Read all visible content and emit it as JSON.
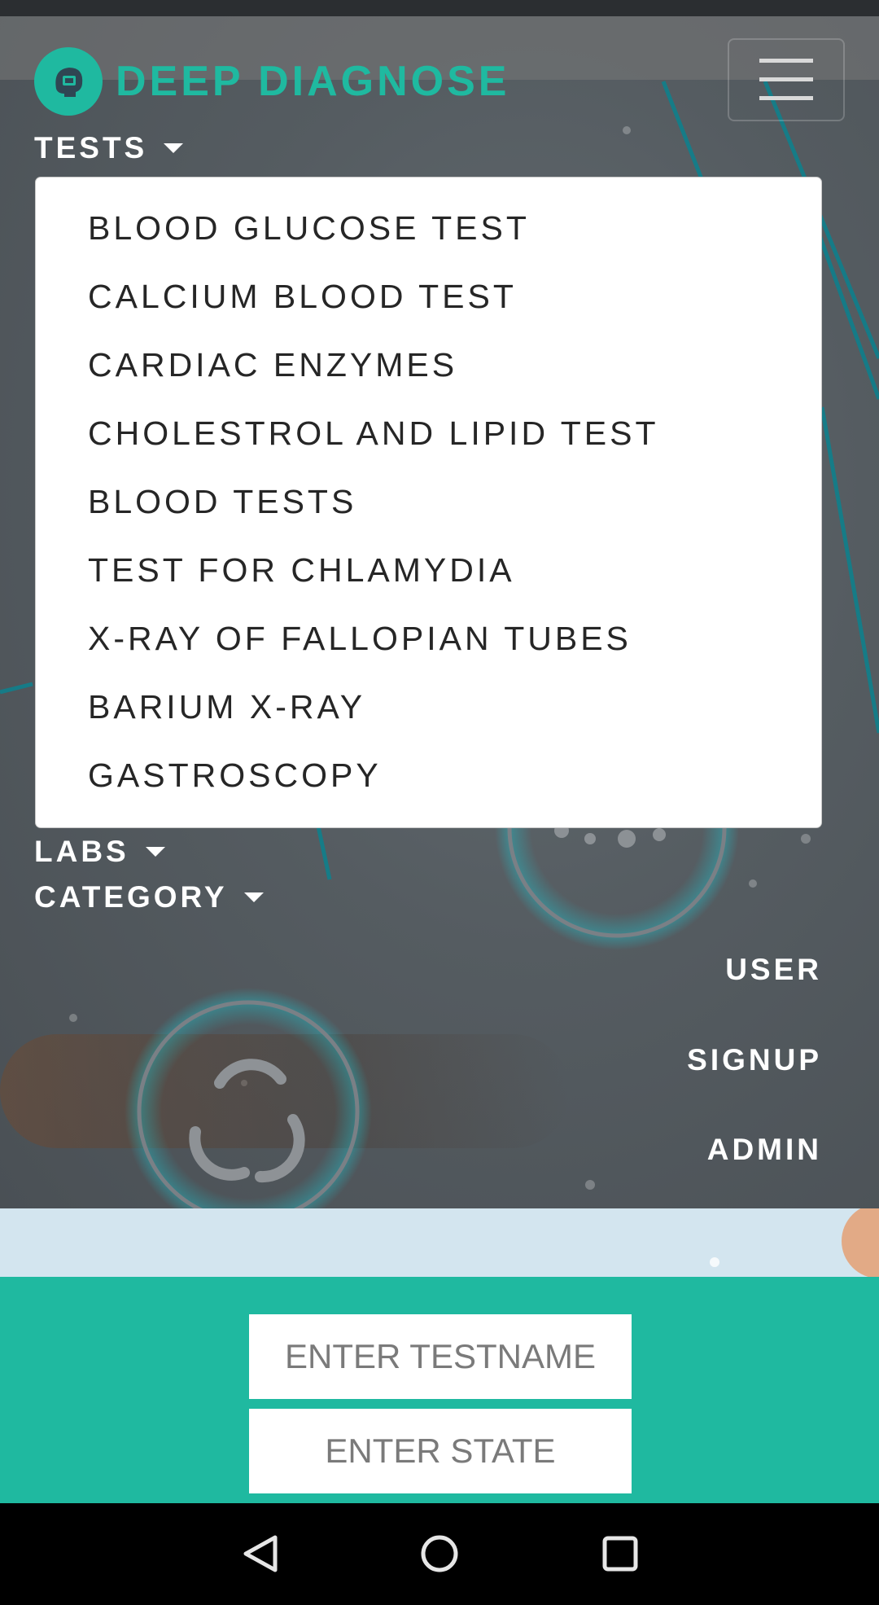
{
  "brand": {
    "name": "DEEP DIAGNOSE",
    "accent_color": "#1fb9a0",
    "logo_icon": "brain-scan-icon"
  },
  "header": {
    "menu_icon": "hamburger-menu-icon"
  },
  "nav": {
    "tests_label": "TESTS",
    "labs_label": "LABS",
    "category_label": "CATEGORY",
    "user_label": "USER",
    "signup_label": "SIGNUP",
    "admin_label": "ADMIN"
  },
  "tests_dropdown": {
    "items": [
      "BLOOD GLUCOSE TEST",
      "CALCIUM BLOOD TEST",
      "CARDIAC ENZYMES",
      "CHOLESTROL AND LIPID TEST",
      "BLOOD TESTS",
      "TEST FOR CHLAMYDIA",
      "X-RAY OF FALLOPIAN TUBES",
      "BARIUM X-RAY",
      "GASTROSCOPY"
    ]
  },
  "search": {
    "testname_placeholder": "ENTER TESTNAME",
    "state_placeholder": "ENTER STATE",
    "background_color": "#1fb9a0"
  },
  "system_nav": {
    "back_icon": "back-triangle-icon",
    "home_icon": "home-circle-icon",
    "recents_icon": "recents-square-icon"
  }
}
